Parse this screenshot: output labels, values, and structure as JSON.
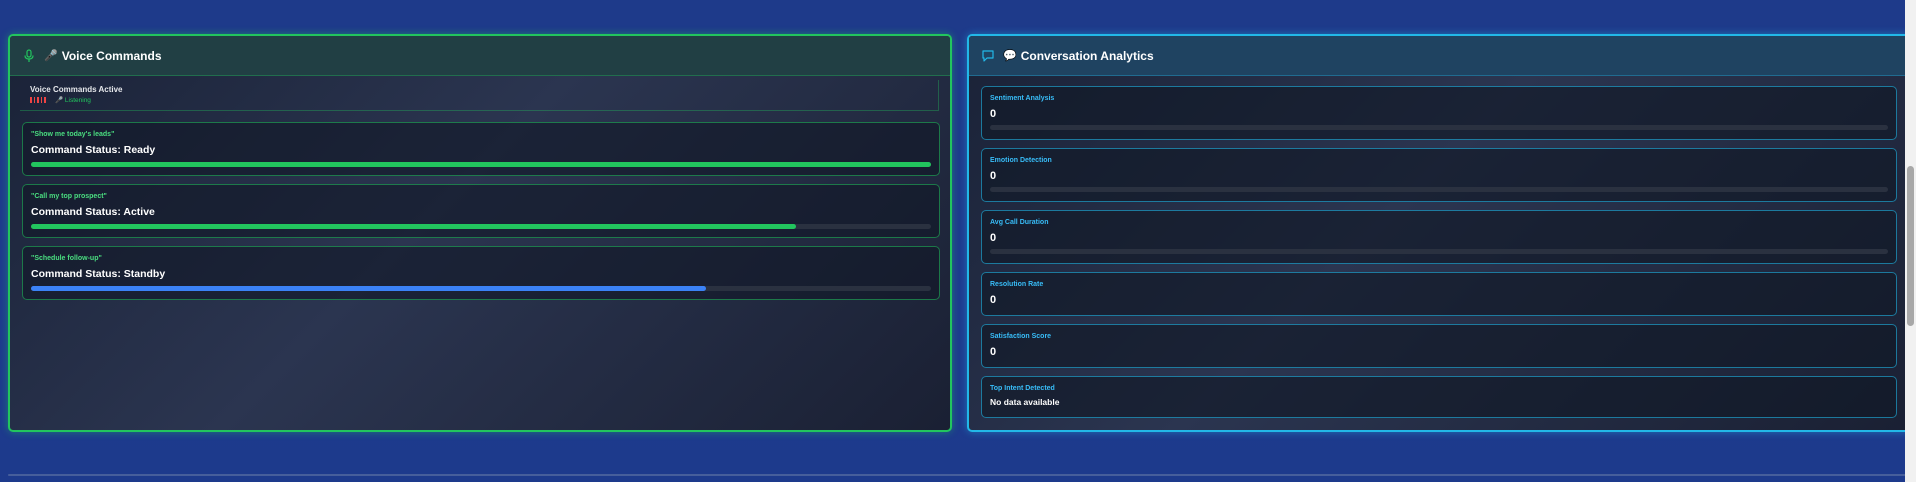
{
  "voice_panel": {
    "title": "Voice Commands",
    "title_emoji": "🎤",
    "status": {
      "title": "Voice Commands Active",
      "listening": "🎤 Listening"
    },
    "commands": [
      {
        "quote": "\"Show me today's leads\"",
        "status": "Command Status: Ready",
        "progress": 1.0,
        "color": "#22c55e"
      },
      {
        "quote": "\"Call my top prospect\"",
        "status": "Command Status: Active",
        "progress": 0.85,
        "color": "#22c55e"
      },
      {
        "quote": "\"Schedule follow-up\"",
        "status": "Command Status: Standby",
        "progress": 0.75,
        "color": "#3b82f6"
      }
    ]
  },
  "conversation_panel": {
    "title": "Conversation Analytics",
    "title_emoji": "💬",
    "metrics": [
      {
        "label": "Sentiment Analysis",
        "value": "0",
        "has_bar": true
      },
      {
        "label": "Emotion Detection",
        "value": "0",
        "has_bar": true
      },
      {
        "label": "Avg Call Duration",
        "value": "0",
        "has_bar": true
      },
      {
        "label": "Resolution Rate",
        "value": "0",
        "has_bar": false
      },
      {
        "label": "Satisfaction Score",
        "value": "0",
        "has_bar": false
      },
      {
        "label": "Top Intent Detected",
        "value": "No data available",
        "has_bar": false
      }
    ]
  },
  "colors": {
    "green": "#22c55e",
    "cyan": "#22b8e8",
    "blue": "#3b82f6",
    "background": "#1e3a8a"
  }
}
